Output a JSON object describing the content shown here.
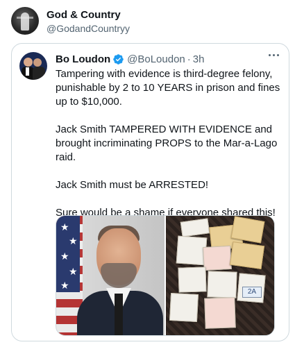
{
  "outer": {
    "name": "God & Country",
    "handle": "@GodandCountryy"
  },
  "tweet": {
    "name": "Bo Loudon",
    "handle": "@BoLoudon",
    "separator": "·",
    "time": "3h",
    "paragraphs": [
      "Tampering with evidence is third-degree felony, punishable by 2 to 10 YEARS in prison and fines up to $10,000.",
      "Jack Smith TAMPERED WITH EVIDENCE and brought incriminating PROPS to the Mar-a-Lago raid.",
      "Jack Smith must be ARRESTED!",
      "Sure would be a shame if everyone shared this!"
    ],
    "photo_label": "2A"
  },
  "colors": {
    "verified": "#1d9bf0",
    "muted_text": "#536471",
    "border": "#cfd9de"
  },
  "icons": [
    "verified-badge-icon",
    "more-options-icon"
  ]
}
